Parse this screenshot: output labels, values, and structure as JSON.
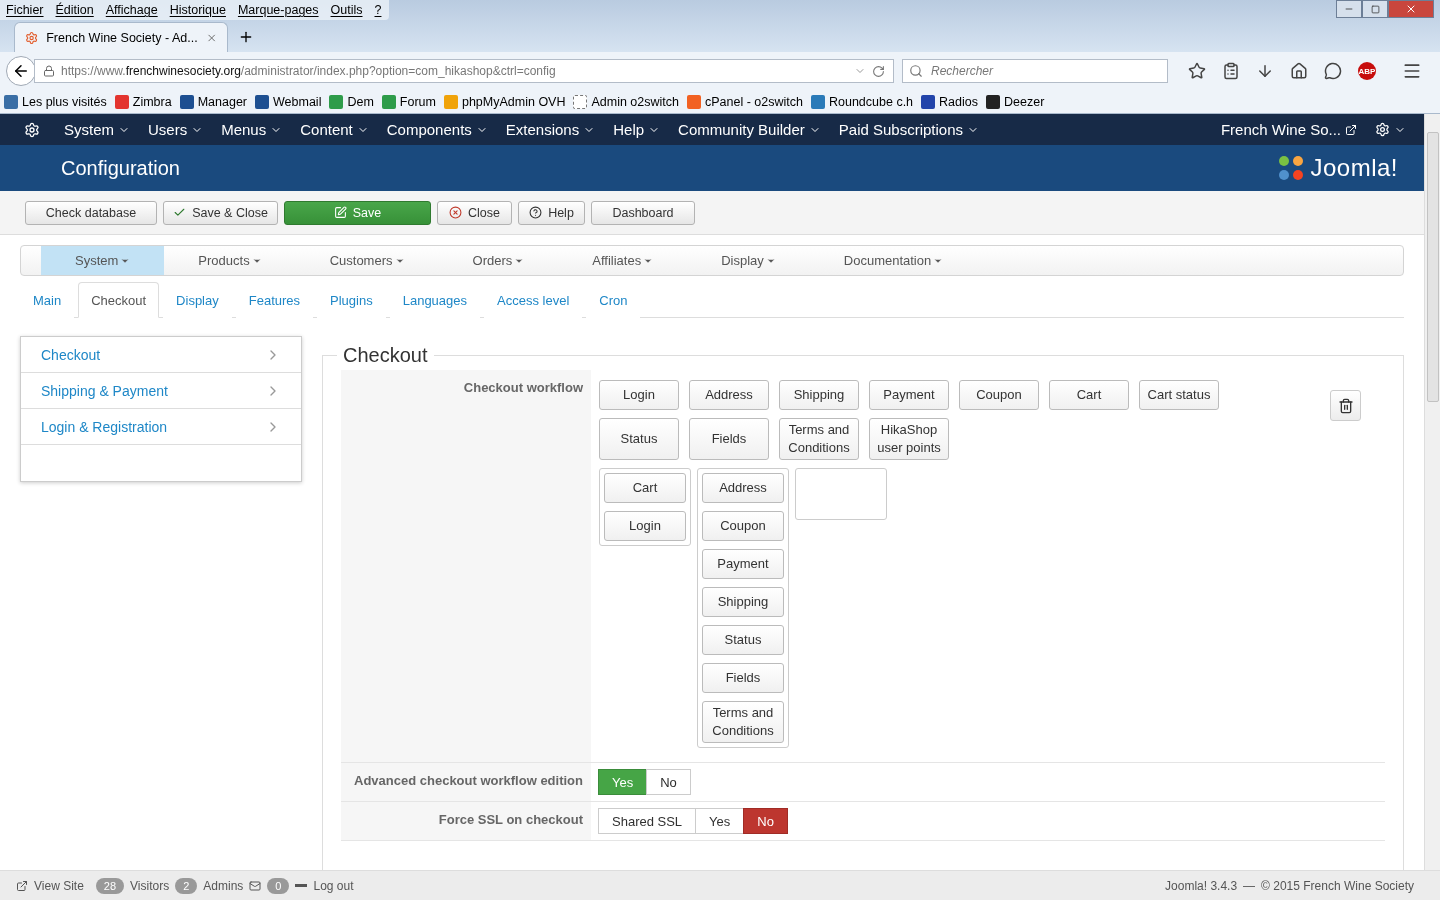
{
  "browser": {
    "menu": [
      "Fichier",
      "Édition",
      "Affichage",
      "Historique",
      "Marque-pages",
      "Outils",
      "?"
    ],
    "tab": {
      "title": "French Wine Society - Ad..."
    },
    "url": {
      "prefix": "https://www.",
      "domain": "frenchwinesociety.org",
      "path": "/administrator/index.php?option=com_hikashop&ctrl=config"
    },
    "search": {
      "placeholder": "Rechercher"
    },
    "addon_badge": "ABP",
    "bookmarks": [
      "Les plus visités",
      "Zimbra",
      "Manager",
      "Webmail",
      "Dem",
      "Forum",
      "phpMyAdmin OVH",
      "Admin o2switch",
      "cPanel - o2switch",
      "Roundcube c.h",
      "Radios",
      "Deezer"
    ]
  },
  "admin_nav": {
    "items": [
      "System",
      "Users",
      "Menus",
      "Content",
      "Components",
      "Extensions",
      "Help",
      "Community Builder",
      "Paid Subscriptions"
    ],
    "site_link": "French Wine So..."
  },
  "header": {
    "title": "Configuration",
    "logo": "Joomla!"
  },
  "toolbar": [
    {
      "label": "Check database",
      "kind": "plain"
    },
    {
      "label": "Save & Close",
      "kind": "check"
    },
    {
      "label": "Save",
      "kind": "primary"
    },
    {
      "label": "Close",
      "kind": "close"
    },
    {
      "label": "Help",
      "kind": "help"
    },
    {
      "label": "Dashboard",
      "kind": "plain"
    }
  ],
  "submenu": [
    {
      "label": "System",
      "selected": true
    },
    {
      "label": "Products",
      "selected": false
    },
    {
      "label": "Customers",
      "selected": false
    },
    {
      "label": "Orders",
      "selected": false
    },
    {
      "label": "Affiliates",
      "selected": false
    },
    {
      "label": "Display",
      "selected": false
    },
    {
      "label": "Documentation",
      "selected": false
    }
  ],
  "tabs": [
    {
      "label": "Main",
      "selected": false
    },
    {
      "label": "Checkout",
      "selected": true
    },
    {
      "label": "Display",
      "selected": false
    },
    {
      "label": "Features",
      "selected": false
    },
    {
      "label": "Plugins",
      "selected": false
    },
    {
      "label": "Languages",
      "selected": false
    },
    {
      "label": "Access level",
      "selected": false
    },
    {
      "label": "Cron",
      "selected": false
    }
  ],
  "sidebar": [
    "Checkout",
    "Shipping & Payment",
    "Login & Registration"
  ],
  "section_title": "Checkout",
  "workflow": {
    "label": "Checkout workflow",
    "available": [
      "Login",
      "Address",
      "Shipping",
      "Payment",
      "Coupon",
      "Cart",
      "Cart status",
      "Status",
      "Fields",
      "Terms and Conditions",
      "HikaShop user points"
    ],
    "steps": [
      [
        "Cart",
        "Login"
      ],
      [
        "Address",
        "Coupon",
        "Payment",
        "Shipping",
        "Status",
        "Fields",
        "Terms and Conditions"
      ]
    ]
  },
  "switches": [
    {
      "label": "Advanced checkout workflow edition",
      "options": [
        {
          "label": "Yes",
          "selected": true,
          "kind": "positive"
        },
        {
          "label": "No",
          "selected": false,
          "kind": "negative"
        }
      ]
    },
    {
      "label": "Force SSL on checkout",
      "options": [
        {
          "label": "Shared SSL",
          "selected": false,
          "kind": "neutral"
        },
        {
          "label": "Yes",
          "selected": false,
          "kind": "positive"
        },
        {
          "label": "No",
          "selected": true,
          "kind": "negative"
        }
      ]
    }
  ],
  "status_bar": {
    "view_site": "View Site",
    "visitors_count": "28",
    "visitors": "Visitors",
    "admins_count": "2",
    "admins": "Admins",
    "messages_count": "0",
    "logout": "Log out",
    "version": "Joomla! 3.4.3",
    "separator": "—",
    "copyright": "© 2015 French Wine Society"
  }
}
